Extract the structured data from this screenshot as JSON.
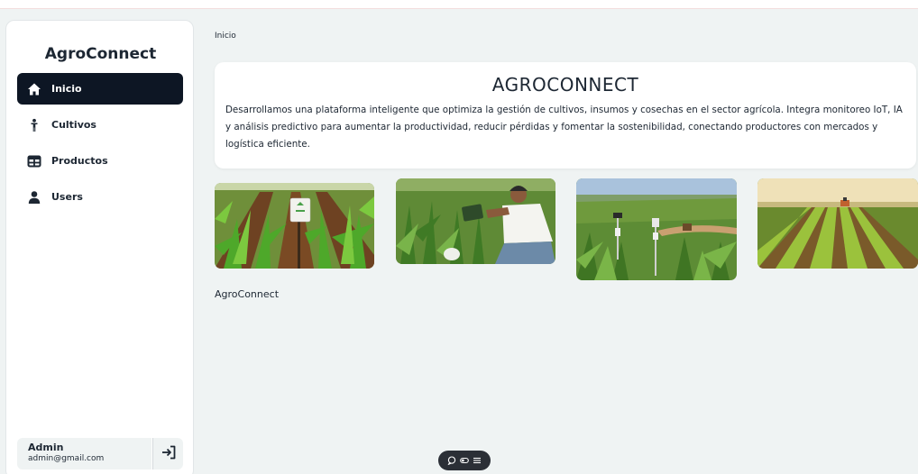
{
  "app": {
    "brand": "AgroConnect"
  },
  "sidebar": {
    "items": [
      {
        "label": "Inicio",
        "icon": "home-icon",
        "active": true
      },
      {
        "label": "Cultivos",
        "icon": "person-icon",
        "active": false
      },
      {
        "label": "Productos",
        "icon": "table-icon",
        "active": false
      },
      {
        "label": "Users",
        "icon": "user-icon",
        "active": false
      }
    ],
    "user": {
      "name": "Admin",
      "email": "admin@gmail.com"
    },
    "logout_icon": "logout-icon"
  },
  "main": {
    "breadcrumb": "Inicio",
    "hero": {
      "title": "AGROCONNECT",
      "description": "Desarrollamos una plataforma inteligente que optimiza la gestión de cultivos, insumos y cosechas en el sector agrícola. Integra monitoreo IoT, IA y análisis predictivo para aumentar la productividad, reducir pérdidas y fomentar la sostenibilidad, conectando productores con mercados y logística eficiente."
    },
    "footer_label": "AgroConnect"
  },
  "floating_toolbar": {
    "icons": [
      "comment-icon",
      "toggle-icon",
      "menu-icon"
    ]
  },
  "colors": {
    "background": "#eff3f3",
    "active_nav": "#0d1624",
    "text": "#1d2733"
  }
}
